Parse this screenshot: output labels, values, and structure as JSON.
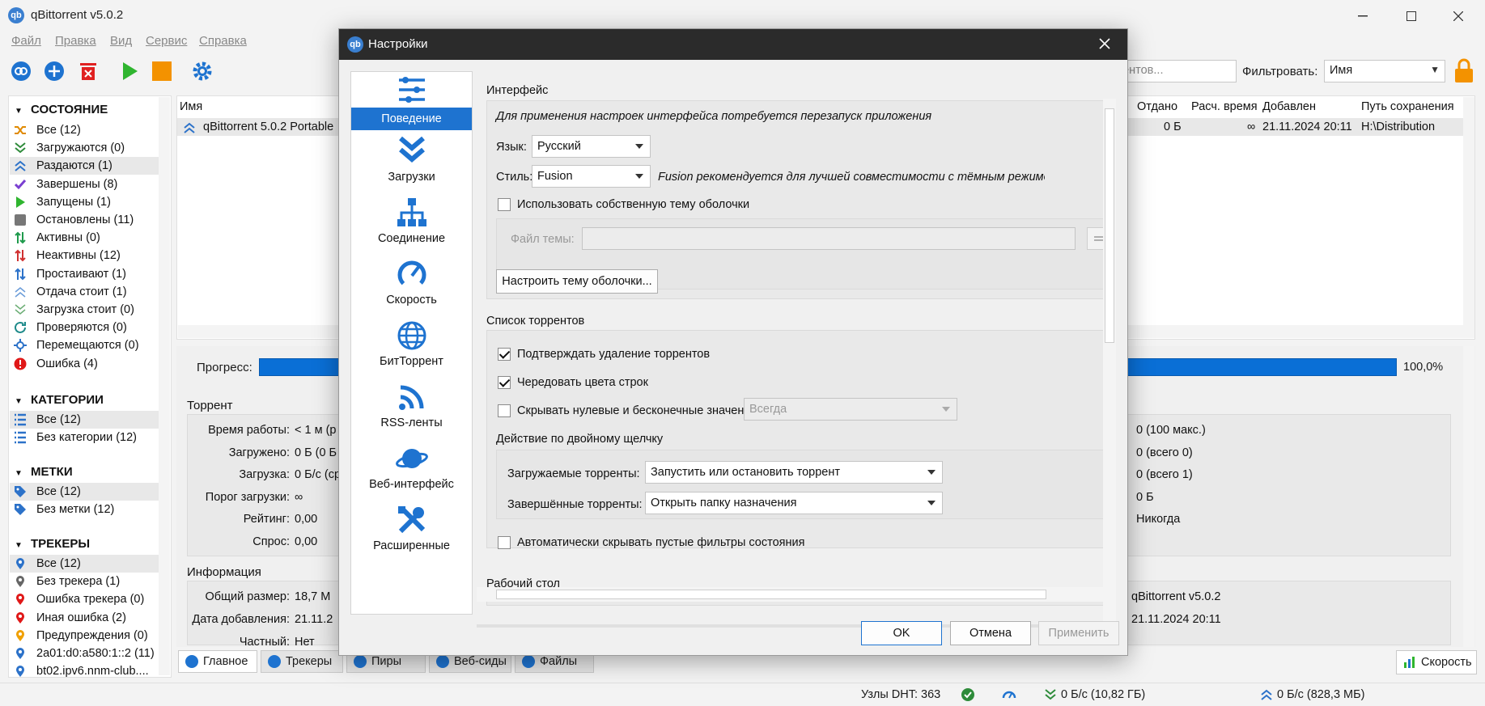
{
  "app": {
    "title": "qBittorrent v5.0.2",
    "icon": "qb"
  },
  "menu": [
    "Файл",
    "Правка",
    "Вид",
    "Сервис",
    "Справка"
  ],
  "toolbar": {
    "search_placeholder": "рентов...",
    "filter_label": "Фильтровать:",
    "filter_value": "Имя"
  },
  "sidebar": {
    "status_title": "СОСТОЯНИЕ",
    "status": [
      {
        "label": "Все (12)",
        "icon": "shuffle-icon",
        "color": "#e08a00"
      },
      {
        "label": "Загружаются (0)",
        "icon": "download-chevrons-icon",
        "color": "#2e8b3a"
      },
      {
        "label": "Раздаются (1)",
        "icon": "upload-chevrons-icon",
        "color": "#2c72c9"
      },
      {
        "label": "Завершены (8)",
        "icon": "checkmark-icon",
        "color": "#7a3fd1"
      },
      {
        "label": "Запущены (1)",
        "icon": "play-icon",
        "color": "#2fb52f"
      },
      {
        "label": "Остановлены (11)",
        "icon": "stop-square-icon",
        "color": "#777777"
      },
      {
        "label": "Активны (0)",
        "icon": "arrows-updown-icon",
        "color": "#1f9a4c"
      },
      {
        "label": "Неактивны (12)",
        "icon": "arrows-updown-red-icon",
        "color": "#d03030"
      },
      {
        "label": "Простаивают (1)",
        "icon": "arrows-updown-stalled-icon",
        "color": "#2c72c9"
      },
      {
        "label": "Отдача стоит (1)",
        "icon": "upload-stalled-icon",
        "color": "#2c72c9"
      },
      {
        "label": "Загрузка стоит (0)",
        "icon": "download-stalled-icon",
        "color": "#2e8b3a"
      },
      {
        "label": "Проверяются (0)",
        "icon": "refresh-icon",
        "color": "#1e8a8a"
      },
      {
        "label": "Перемещаются (0)",
        "icon": "move-icon",
        "color": "#2c72c9"
      },
      {
        "label": "Ошибка (4)",
        "icon": "error-icon",
        "color": "#e01818"
      }
    ],
    "categories_title": "КАТЕГОРИИ",
    "categories": [
      {
        "label": "Все (12)"
      },
      {
        "label": "Без категории (12)"
      }
    ],
    "tags_title": "МЕТКИ",
    "tags": [
      {
        "label": "Все (12)"
      },
      {
        "label": "Без метки (12)"
      }
    ],
    "trackers_title": "ТРЕКЕРЫ",
    "trackers": [
      {
        "label": "Все (12)",
        "color": "#2c72c9"
      },
      {
        "label": "Без трекера (1)",
        "color": "#666666"
      },
      {
        "label": "Ошибка трекера (0)",
        "color": "#e01818"
      },
      {
        "label": "Иная ошибка (2)",
        "color": "#e01818"
      },
      {
        "label": "Предупреждения (0)",
        "color": "#f0a000"
      },
      {
        "label": "2a01:d0:a580:1::2 (11)",
        "color": "#2c72c9"
      },
      {
        "label": "bt02.ipv6.nnm-club....",
        "color": "#2c72c9"
      }
    ]
  },
  "list": {
    "headers": {
      "name": "Имя",
      "sent": "Отдано",
      "eta": "Расч. время",
      "added": "Добавлен",
      "path": "Путь сохранения"
    },
    "row": {
      "name": "qBittorrent 5.0.2 Portable",
      "sent": "0 Б",
      "eta": "∞",
      "added": "21.11.2024 20:11",
      "path": "H:\\Distribution"
    }
  },
  "details": {
    "progress_label": "Прогресс:",
    "progress_value": "100,0%",
    "progress_fraction": 1.0,
    "torrent_title": "Торрент",
    "torrent_left": [
      {
        "label": "Время работы:",
        "value": "< 1 м (р"
      },
      {
        "label": "Загружено:",
        "value": "0 Б (0 Б"
      },
      {
        "label": "Загрузка:",
        "value": "0 Б/с (ср"
      },
      {
        "label": "Порог загрузки:",
        "value": "∞"
      },
      {
        "label": "Рейтинг:",
        "value": "0,00"
      },
      {
        "label": "Спрос:",
        "value": "0,00"
      }
    ],
    "torrent_right": [
      "0 (100 макс.)",
      "0 (всего 0)",
      "0 (всего 1)",
      "0 Б",
      "Никогда"
    ],
    "info_title": "Информация",
    "info_left": [
      {
        "label": "Общий размер:",
        "value": "18,7 М"
      },
      {
        "label": "Дата добавления:",
        "value": "21.11.2"
      },
      {
        "label": "Частный:",
        "value": "Нет"
      }
    ],
    "info_right": [
      "qBittorrent v5.0.2",
      "21.11.2024 20:11"
    ]
  },
  "tabs": [
    "Главное",
    "Трекеры",
    "Пиры",
    "Веб-сиды",
    "Файлы"
  ],
  "speed_tab": "Скорость",
  "status": {
    "dht": "Узлы DHT: 363",
    "down": "0 Б/с (10,82 ГБ)",
    "up": "0 Б/с (828,3 МБ)"
  },
  "dialog": {
    "title": "Настройки",
    "nav": [
      {
        "label": "Поведение",
        "icon": "sliders-icon"
      },
      {
        "label": "Загрузки",
        "icon": "download-icon"
      },
      {
        "label": "Соединение",
        "icon": "network-icon"
      },
      {
        "label": "Скорость",
        "icon": "speedometer-icon"
      },
      {
        "label": "БитТоррент",
        "icon": "globe-icon"
      },
      {
        "label": "RSS-ленты",
        "icon": "rss-icon"
      },
      {
        "label": "Веб-интерфейс",
        "icon": "planet-icon"
      },
      {
        "label": "Расширенные",
        "icon": "tools-icon"
      }
    ],
    "interface": {
      "title": "Интерфейс",
      "note": "Для применения настроек интерфейса потребуется перезапуск приложения",
      "lang_label": "Язык:",
      "lang_value": "Русский",
      "style_label": "Стиль:",
      "style_value": "Fusion",
      "style_note": "Fusion рекомендуется для лучшей совместимости с тёмным режимом Windo",
      "custom_theme_label": "Использовать собственную тему оболочки",
      "custom_theme_checked": false,
      "theme_file_label": "Файл темы:",
      "theme_file_value": "",
      "customize_button": "Настроить тему оболочки..."
    },
    "torrent_list": {
      "title": "Список торрентов",
      "confirm_delete": "Подтверждать удаление торрентов",
      "confirm_delete_checked": true,
      "alt_rows": "Чередовать цвета строк",
      "alt_rows_checked": true,
      "hide_zero": "Скрывать нулевые и бесконечные значения",
      "hide_zero_checked": false,
      "hide_zero_value": "Всегда",
      "dblclick_title": "Действие по двойному щелчку",
      "downloading_label": "Загружаемые торренты:",
      "downloading_value": "Запустить или остановить торрент",
      "completed_label": "Завершённые торренты:",
      "completed_value": "Открыть папку назначения",
      "auto_hide": "Автоматически скрывать пустые фильтры состояния",
      "auto_hide_checked": false
    },
    "desktop_title": "Рабочий стол",
    "buttons": {
      "ok": "OK",
      "cancel": "Отмена",
      "apply": "Применить"
    }
  }
}
